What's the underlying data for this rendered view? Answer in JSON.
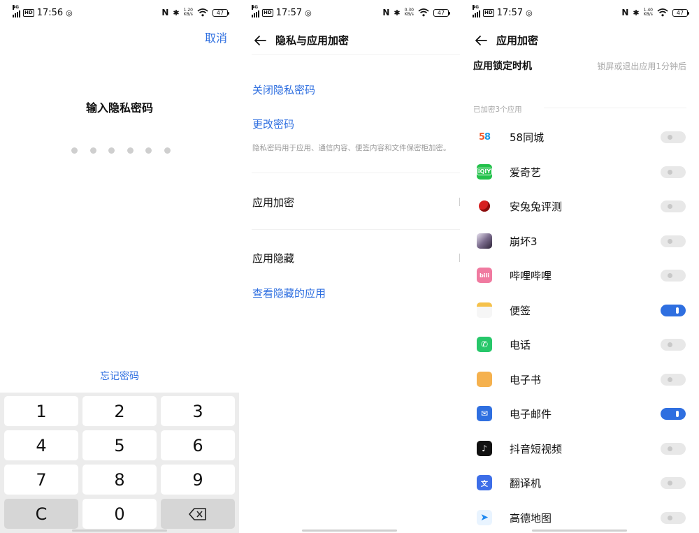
{
  "status_bars": [
    {
      "time": "17:56",
      "speed": "1.20\nKB/s",
      "battery": "47"
    },
    {
      "time": "17:57",
      "speed": "0.30\nKB/s",
      "battery": "47"
    },
    {
      "time": "17:57",
      "speed": "1.40\nKB/s",
      "battery": "47"
    }
  ],
  "screen1": {
    "cancel_label": "取消",
    "title": "输入隐私密码",
    "digit_count": 6,
    "forgot_label": "忘记密码",
    "keys": [
      "1",
      "2",
      "3",
      "4",
      "5",
      "6",
      "7",
      "8",
      "9",
      "C",
      "0",
      "backspace"
    ]
  },
  "screen2": {
    "title": "隐私与应用加密",
    "close_password": "关闭隐私密码",
    "change_password": "更改密码",
    "description": "隐私密码用于应用、通信内容、便签内容和文件保密柜加密。",
    "app_encrypt": "应用加密",
    "app_hide": "应用隐藏",
    "view_hidden": "查看隐藏的应用"
  },
  "screen3": {
    "title": "应用加密",
    "lock_label": "应用锁定时机",
    "lock_value": "锁屏或退出应用1分钟后",
    "section_header": "已加密3个应用",
    "apps": [
      {
        "name": "58同城",
        "on": false,
        "icon": "58-icon"
      },
      {
        "name": "爱奇艺",
        "on": false,
        "icon": "iqiyi-icon"
      },
      {
        "name": "安兔兔评测",
        "on": false,
        "icon": "antutu-icon"
      },
      {
        "name": "崩坏3",
        "on": false,
        "icon": "honkai-icon"
      },
      {
        "name": "哔哩哔哩",
        "on": false,
        "icon": "bilibili-icon"
      },
      {
        "name": "便签",
        "on": true,
        "icon": "notes-icon"
      },
      {
        "name": "电话",
        "on": false,
        "icon": "phone-icon"
      },
      {
        "name": "电子书",
        "on": false,
        "icon": "ebook-icon"
      },
      {
        "name": "电子邮件",
        "on": true,
        "icon": "email-icon"
      },
      {
        "name": "抖音短视频",
        "on": false,
        "icon": "douyin-icon"
      },
      {
        "name": "翻译机",
        "on": false,
        "icon": "translator-icon"
      },
      {
        "name": "高德地图",
        "on": false,
        "icon": "amap-icon"
      }
    ]
  },
  "colors": {
    "accent": "#2f6fe0",
    "toggle_off": "#e8e8e8",
    "keypad_bg": "#ececec"
  }
}
